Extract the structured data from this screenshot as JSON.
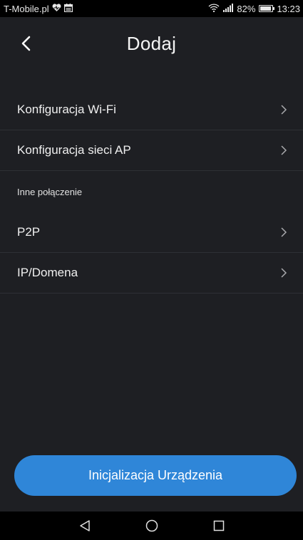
{
  "status_bar": {
    "carrier": "T-Mobile.pl",
    "battery_percent": "82%",
    "battery_level": 0.82,
    "time": "13:23",
    "icons": [
      "heart-icon",
      "calendar-icon",
      "wifi-icon",
      "signal-icon",
      "battery-icon"
    ]
  },
  "header": {
    "title": "Dodaj",
    "back_icon": "chevron-left-icon"
  },
  "list": {
    "items": [
      {
        "label": "Konfiguracja Wi-Fi"
      },
      {
        "label": "Konfiguracja sieci AP"
      }
    ],
    "section_label": "Inne połączenie",
    "other_items": [
      {
        "label": "P2P"
      },
      {
        "label": "IP/Domena"
      }
    ]
  },
  "primary_button": {
    "label": "Inicjalizacja Urządzenia"
  },
  "nav_bar": {
    "icons": [
      "back-triangle-icon",
      "home-circle-icon",
      "recents-square-icon"
    ]
  },
  "colors": {
    "background": "#1e1f23",
    "accent": "#2f86d8",
    "divider": "#2e3035",
    "text": "#f0f0f0"
  }
}
